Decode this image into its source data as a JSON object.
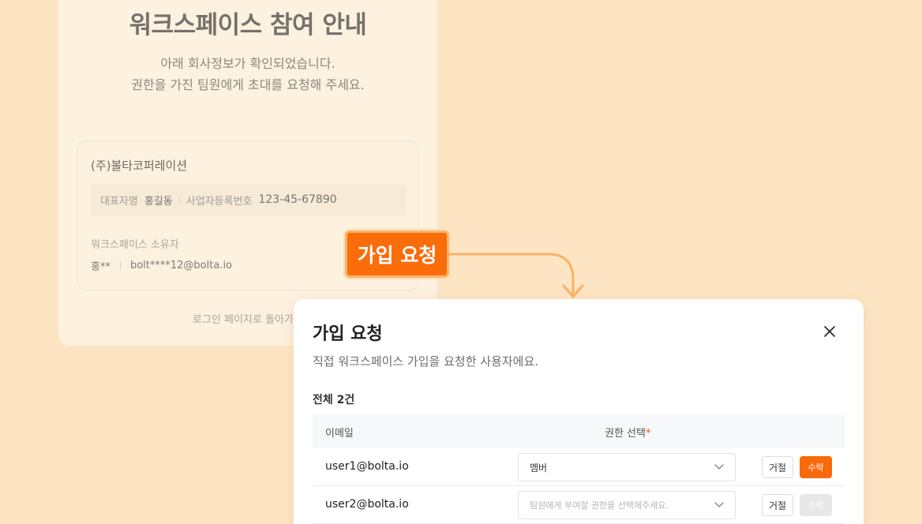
{
  "background_page": {
    "title": "워크스페이스 참여 안내",
    "subtitle_line1": "아래 회사정보가 확인되었습니다.",
    "subtitle_line2": "권한을 가진 팀원에게 초대를 요청해 주세요.",
    "company": {
      "name": "(주)볼타코퍼레이션",
      "ceo_label": "대표자명",
      "ceo_value": "홍길동",
      "biz_no_label": "사업자등록번호",
      "biz_no_value": "123-45-67890",
      "owner_label": "워크스페이스 소유자",
      "owner_name": "홍**",
      "owner_email": "bolt****12@bolta.io"
    },
    "back_link": "로그인 페이지로 돌아가"
  },
  "callout": {
    "label": "가입 요청"
  },
  "modal": {
    "title": "가입 요청",
    "description": "직접 워크스페이스 가입을 요청한 사용자에요.",
    "total": "전체 2건",
    "columns": {
      "email": "이메일",
      "role": "권한 선택",
      "required_mark": "*"
    },
    "rows": [
      {
        "email": "user1@bolta.io",
        "role": "멤버",
        "reject": "거절",
        "accept": "수락"
      },
      {
        "email": "user2@bolta.io",
        "role_placeholder": "팀원에게 부여할 권한을 선택해주세요.",
        "reject": "거절",
        "accept": "수락"
      }
    ]
  },
  "colors": {
    "accent": "#f86a0c",
    "background": "#fde5c4",
    "card": "#fdf1df",
    "disabled": "#e8e8e8"
  },
  "icons": {
    "close": "close-icon",
    "chevron": "chevron-down-icon",
    "arrow": "curved-arrow-icon"
  }
}
